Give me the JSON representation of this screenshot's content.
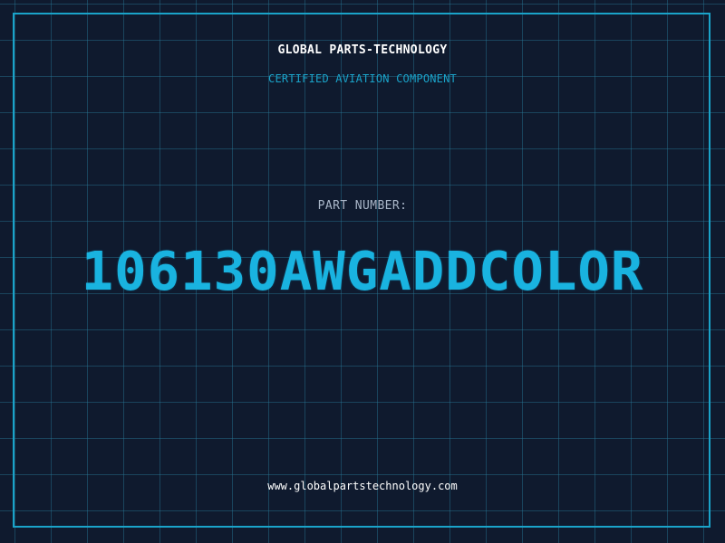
{
  "header": {
    "company_name": "GLOBAL PARTS-TECHNOLOGY",
    "subtitle": "CERTIFIED AVIATION COMPONENT"
  },
  "part": {
    "label": "PART NUMBER:",
    "number": "106130AWGADDCOLOR"
  },
  "footer": {
    "website": "www.globalpartstechnology.com"
  },
  "colors": {
    "background": "#0f1a2e",
    "grid": "#287896",
    "accent": "#19b3e0",
    "frame": "#1aa3c9",
    "label": "#a9b6c8",
    "text": "#ffffff"
  }
}
